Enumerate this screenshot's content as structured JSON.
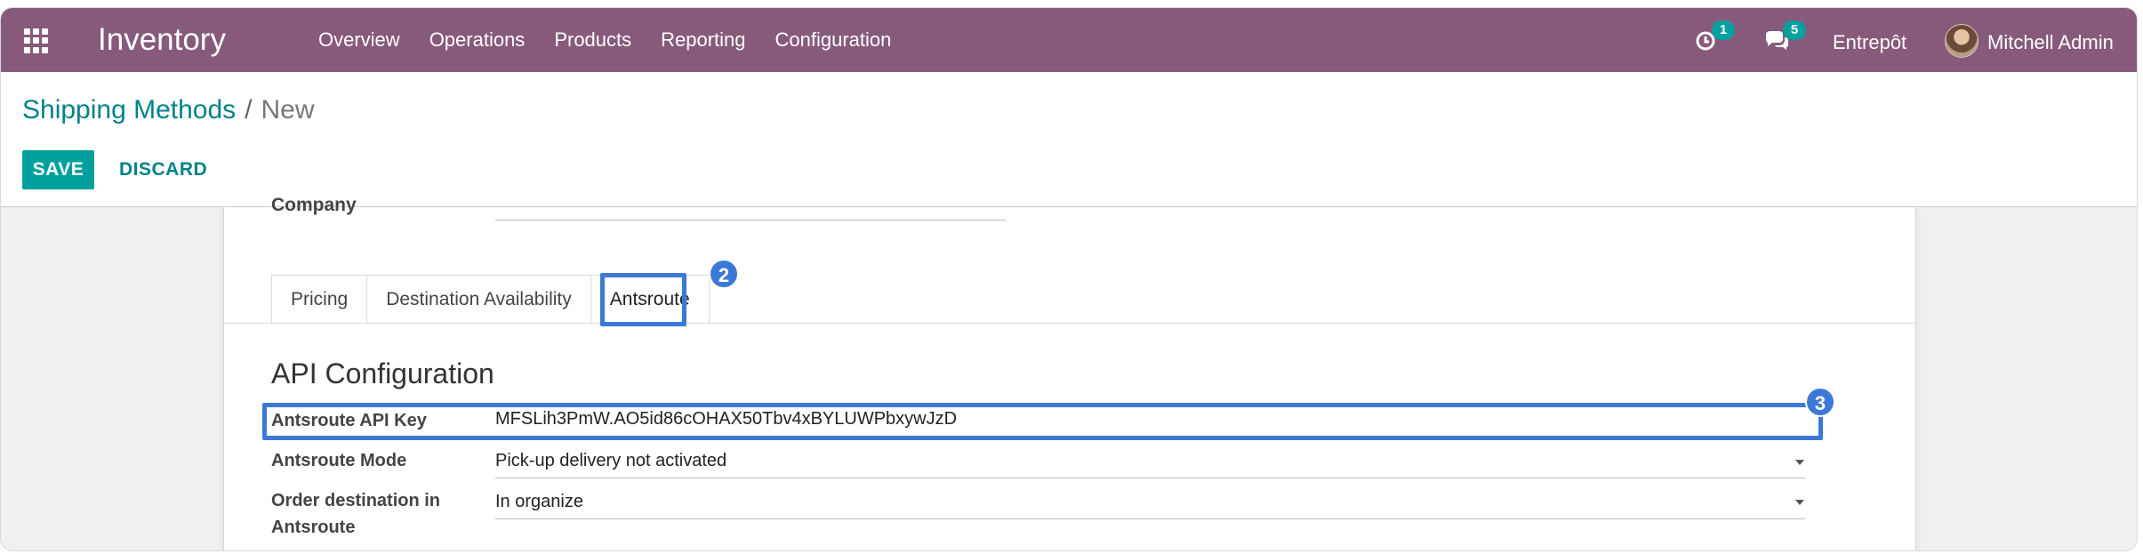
{
  "navbar": {
    "app_name": "Inventory",
    "menu": [
      "Overview",
      "Operations",
      "Products",
      "Reporting",
      "Configuration"
    ],
    "activity_count": "1",
    "message_count": "5",
    "company": "Entrepôt",
    "user": "Mitchell Admin",
    "icons": {
      "apps": "apps-grid-icon",
      "activity": "clock-icon",
      "messages": "chat-bubbles-icon"
    }
  },
  "breadcrumb": {
    "parent": "Shipping Methods",
    "separator": "/",
    "current": "New"
  },
  "actions": {
    "save": "SAVE",
    "discard": "DISCARD"
  },
  "form": {
    "company_label": "Company",
    "tabs": [
      {
        "label": "Pricing"
      },
      {
        "label": "Destination Availability"
      },
      {
        "label": "Antsroute",
        "active": true
      }
    ],
    "section_title": "API Configuration",
    "fields": {
      "api_key": {
        "label": "Antsroute API Key",
        "value": "MFSLih3PmW.AO5id86cOHAX50Tbv4xBYLUWPbxywJzD"
      },
      "mode": {
        "label": "Antsroute Mode",
        "value": "Pick-up delivery not activated"
      },
      "order_destination": {
        "label_line1": "Order destination in",
        "label_line2": "Antsroute",
        "value": "In organize"
      }
    }
  },
  "annotations": {
    "step_tab": "2",
    "step_field": "3"
  },
  "colors": {
    "navbar": "#875a7b",
    "primary": "#00a09d",
    "link": "#00828a",
    "highlight": "#3c78d8"
  }
}
